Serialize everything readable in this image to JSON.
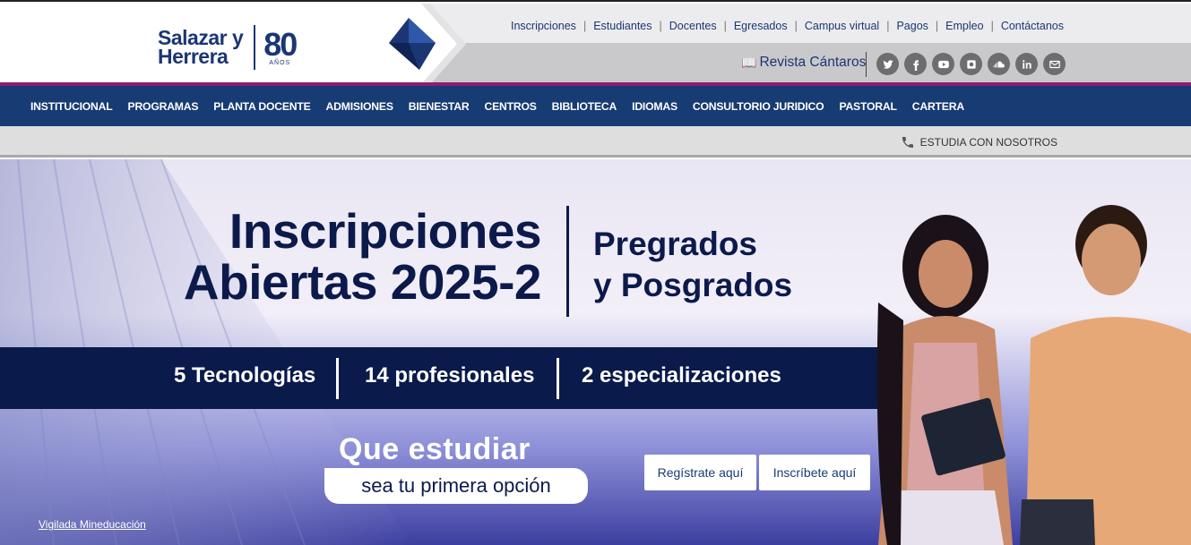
{
  "brand": {
    "name_line1": "Salazar y",
    "name_line2": "Herrera",
    "anniversary": "80",
    "anniversary_label": "AÑOS"
  },
  "utility_links": [
    "Inscripciones",
    "Estudiantes",
    "Docentes",
    "Egresados",
    "Campus virtual",
    "Pagos",
    "Empleo",
    "Contáctanos"
  ],
  "revista": {
    "label": "Revista Cántaros",
    "icon": "book-icon"
  },
  "socials": [
    "twitter-icon",
    "facebook-icon",
    "youtube-icon",
    "flickr-icon",
    "soundcloud-icon",
    "linkedin-icon",
    "email-icon"
  ],
  "main_nav": [
    "INSTITUCIONAL",
    "PROGRAMAS",
    "PLANTA DOCENTE",
    "ADMISIONES",
    "BIENESTAR",
    "CENTROS",
    "BIBLIOTECA",
    "IDIOMAS",
    "CONSULTORIO JURIDICO",
    "PASTORAL",
    "CARTERA"
  ],
  "subbar": {
    "study_label": "ESTUDIA CON NOSOTROS",
    "icon": "phone-icon"
  },
  "hero": {
    "title_line1": "Inscripciones",
    "title_line2": "Abiertas 2025-2",
    "subtitle_line1": "Pregrados",
    "subtitle_line2": "y Posgrados",
    "band": [
      "5 Tecnologías",
      "14 profesionales",
      "2 especializaciones"
    ],
    "tagline_line1": "Que estudiar",
    "tagline_line2": "sea tu primera opción",
    "buttons": [
      "Regístrate aquí",
      "Inscríbete aquí"
    ],
    "footer_note": "Vigilada Mineducación"
  },
  "colors": {
    "navy": "#173b73",
    "dark_navy": "#0a1a4a",
    "magenta": "#8a1e72",
    "social_gray": "#6d6d6f"
  }
}
